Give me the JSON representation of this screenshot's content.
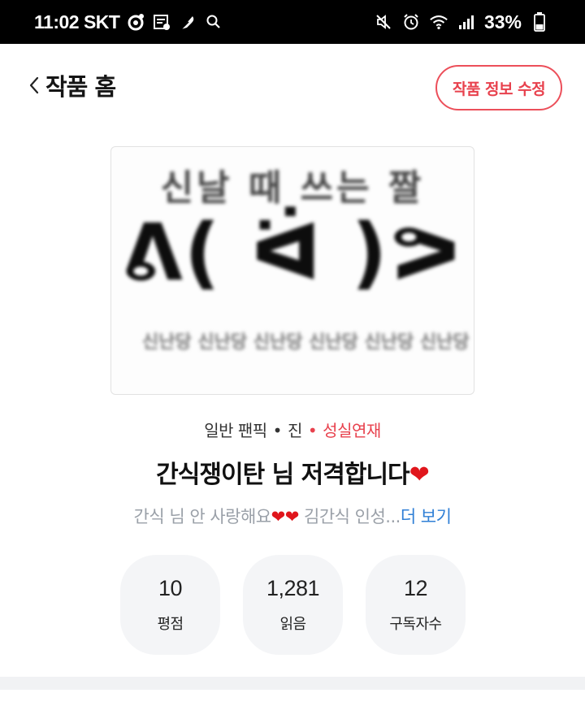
{
  "status_bar": {
    "time_carrier": "11:02 SKT",
    "battery": "33%",
    "icons": [
      "record-icon",
      "news-icon",
      "feather-icon",
      "search-icon",
      "mute-icon",
      "alarm-icon",
      "wifi-icon",
      "signal-icon",
      "battery-icon"
    ]
  },
  "header": {
    "back_icon": "chevron-left-icon",
    "title": "작품 홈",
    "edit_button": "작품 정보 수정"
  },
  "cover": {
    "line1": "신날 때 쓰는 짤",
    "line2": "ᕕ( ᐛ )ᕗ",
    "line3": "신난당 신난당 신난당 신난당 신난당 신난당"
  },
  "meta": {
    "category": "일반 팬픽",
    "sep1": "•",
    "genre": "진",
    "sep2": "•",
    "status": "성실연재"
  },
  "work": {
    "title": "간식쟁이탄 님 저격합니다",
    "title_heart": "❤",
    "description": "간식 님 안 사랑해요",
    "description_hearts": "❤❤",
    "description_rest": " 김간식 인성...",
    "more": "더 보기"
  },
  "stats": [
    {
      "value": "10",
      "label": "평점"
    },
    {
      "value": "1,281",
      "label": "읽음"
    },
    {
      "value": "12",
      "label": "구독자수"
    }
  ],
  "colors": {
    "accent": "#e8414d",
    "link": "#2f7fd6",
    "muted": "#9aa0a8",
    "stat_bg": "#f4f5f7"
  }
}
